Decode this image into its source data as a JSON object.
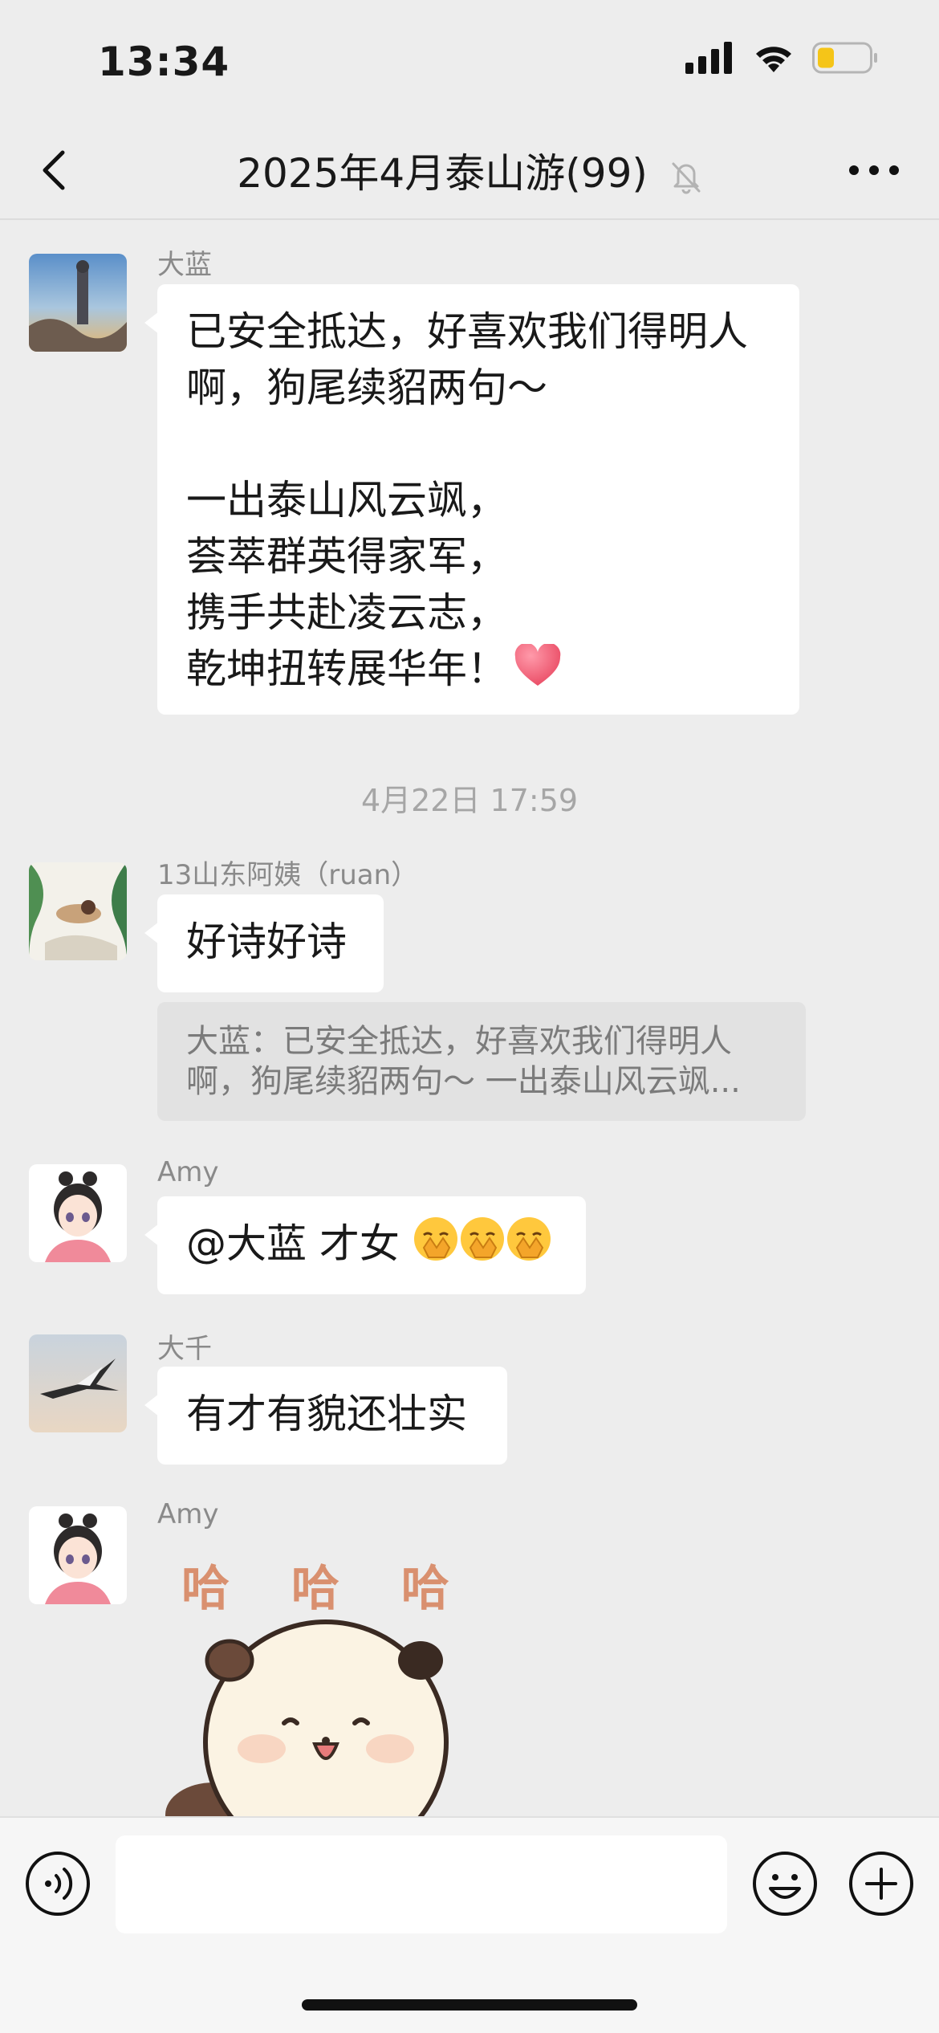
{
  "status": {
    "time": "13:34"
  },
  "nav": {
    "title": "2025年4月泰山游(99)"
  },
  "messages": [
    {
      "sender": "大蓝",
      "lines": [
        "已安全抵达，好喜欢我们得明人",
        "啊，狗尾续貂两句～",
        "",
        "一出泰山风云飒，",
        "荟萃群英得家军，",
        "携手共赴凌云志，",
        "乾坤扭转展华年！"
      ],
      "trailing_emoji": "heart"
    },
    {
      "timestamp": "4月22日 17:59"
    },
    {
      "sender": "13山东阿姨（ruan）",
      "text": "好诗好诗",
      "quote": [
        "大蓝：已安全抵达，好喜欢我们得明人",
        "啊，狗尾续貂两句～ 一出泰山风云飒..."
      ]
    },
    {
      "sender": "Amy",
      "text": "@大蓝 才女",
      "emoji": "hand-over-mouth-face x3"
    },
    {
      "sender": "大千",
      "text": "有才有貌还壮实"
    },
    {
      "sender": "Amy",
      "sticker_text": "哈 哈 哈",
      "sticker": "laughing-panda"
    }
  ],
  "input": {
    "value": ""
  }
}
